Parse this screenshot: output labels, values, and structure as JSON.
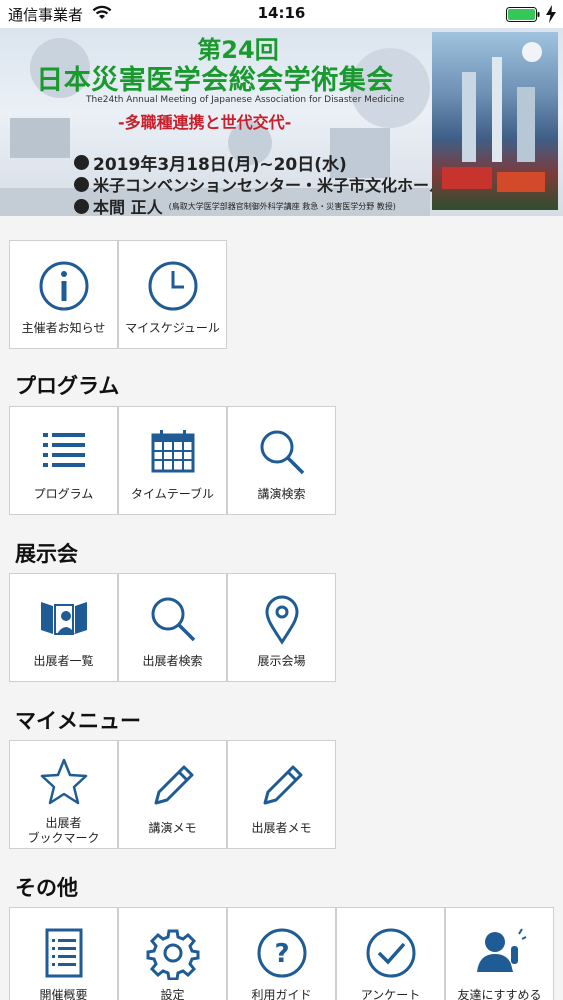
{
  "status_bar": {
    "carrier": "通信事業者",
    "time": "14:16"
  },
  "banner": {
    "number": "第24回",
    "name": "日本災害医学会総会学術集会",
    "english": "The24th Annual Meeting of Japanese Association for Disaster Medicine",
    "subtitle": "-多職種連携と世代交代-",
    "date": "2019年3月18日(月)~20日(水)",
    "venue": "米子コンベンションセンター・米子市文化ホール",
    "chair": "本間 正人",
    "chair_affiliation": "(鳥取大学医学部器官制御外科学講座 救急・災害医学分野 教授)"
  },
  "top_tiles": [
    {
      "label": "主催者お知らせ",
      "icon": "info-icon"
    },
    {
      "label": "マイスケジュール",
      "icon": "clock-icon"
    }
  ],
  "sections": [
    {
      "title": "プログラム",
      "tiles": [
        {
          "label": "プログラム",
          "icon": "list-icon"
        },
        {
          "label": "タイムテーブル",
          "icon": "calendar-icon"
        },
        {
          "label": "講演検索",
          "icon": "search-icon"
        }
      ]
    },
    {
      "title": "展示会",
      "tiles": [
        {
          "label": "出展者一覧",
          "icon": "exhibitor-icon"
        },
        {
          "label": "出展者検索",
          "icon": "search-icon"
        },
        {
          "label": "展示会場",
          "icon": "map-pin-icon"
        }
      ]
    },
    {
      "title": "マイメニュー",
      "tiles": [
        {
          "label": "出展者\nブックマーク",
          "icon": "star-icon"
        },
        {
          "label": "講演メモ",
          "icon": "pencil-icon"
        },
        {
          "label": "出展者メモ",
          "icon": "pencil-icon"
        }
      ]
    },
    {
      "title": "その他",
      "tiles": [
        {
          "label": "開催概要",
          "icon": "document-icon"
        },
        {
          "label": "設定",
          "icon": "gear-icon"
        },
        {
          "label": "利用ガイド",
          "icon": "help-icon"
        },
        {
          "label": "アンケート",
          "icon": "check-icon"
        },
        {
          "label": "友達にすすめる",
          "icon": "recommend-icon"
        }
      ]
    }
  ],
  "colors": {
    "icon": "#1f5b94",
    "title_green": "#1a9a2e",
    "subtitle_red": "#c8202c"
  }
}
